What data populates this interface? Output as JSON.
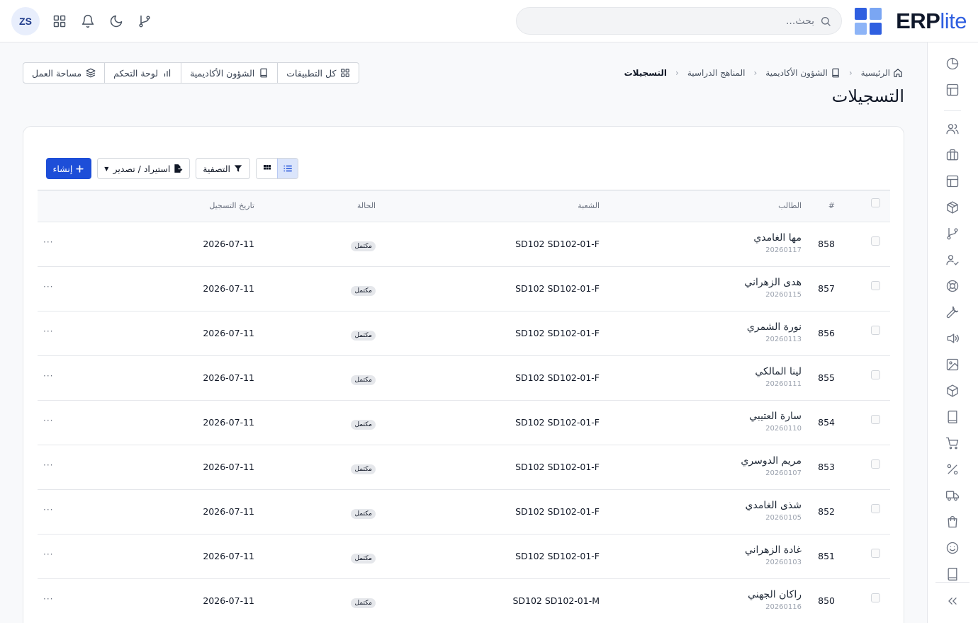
{
  "brand": {
    "prefix": "ERP",
    "suffix": "lite",
    "colors": [
      "#2f5fe0",
      "#5a8ef0",
      "#8db4f7",
      "#2f5fe0"
    ]
  },
  "search": {
    "placeholder": "بحث..."
  },
  "user": {
    "initials": "ZS"
  },
  "breadcrumb": {
    "items": [
      "الرئيسية",
      "الشؤون الأكاديمية",
      "المناهج الدراسية"
    ],
    "current": "التسجيلات"
  },
  "page": {
    "title": "التسجيلات"
  },
  "quicklinks": [
    "كل التطبيقات",
    "الشؤون الأكاديمية",
    "لوحة التحكم",
    "مساحة العمل"
  ],
  "toolbar": {
    "filter": "التصفية",
    "import_export": "استيراد / تصدير",
    "create": "إنشاء"
  },
  "table": {
    "columns": [
      "#",
      "الطالب",
      "الشعبة",
      "الحالة",
      "تاريخ التسجيل"
    ],
    "actions_label": "···",
    "rows": [
      {
        "num": "858",
        "name": "مها الغامدي",
        "sid": "20260117",
        "section": "SD102 SD102-01-F",
        "status": "مكتمل",
        "date": "2026-07-11"
      },
      {
        "num": "857",
        "name": "هدى الزهراني",
        "sid": "20260115",
        "section": "SD102 SD102-01-F",
        "status": "مكتمل",
        "date": "2026-07-11"
      },
      {
        "num": "856",
        "name": "نورة الشمري",
        "sid": "20260113",
        "section": "SD102 SD102-01-F",
        "status": "مكتمل",
        "date": "2026-07-11"
      },
      {
        "num": "855",
        "name": "لينا المالكي",
        "sid": "20260111",
        "section": "SD102 SD102-01-F",
        "status": "مكتمل",
        "date": "2026-07-11"
      },
      {
        "num": "854",
        "name": "سارة العتيبي",
        "sid": "20260110",
        "section": "SD102 SD102-01-F",
        "status": "مكتمل",
        "date": "2026-07-11"
      },
      {
        "num": "853",
        "name": "مريم الدوسري",
        "sid": "20260107",
        "section": "SD102 SD102-01-F",
        "status": "مكتمل",
        "date": "2026-07-11"
      },
      {
        "num": "852",
        "name": "شذى الغامدي",
        "sid": "20260105",
        "section": "SD102 SD102-01-F",
        "status": "مكتمل",
        "date": "2026-07-11"
      },
      {
        "num": "851",
        "name": "غادة الزهراني",
        "sid": "20260103",
        "section": "SD102 SD102-01-F",
        "status": "مكتمل",
        "date": "2026-07-11"
      },
      {
        "num": "850",
        "name": "راكان الجهني",
        "sid": "20260116",
        "section": "SD102 SD102-01-M",
        "status": "مكتمل",
        "date": "2026-07-11"
      }
    ]
  }
}
